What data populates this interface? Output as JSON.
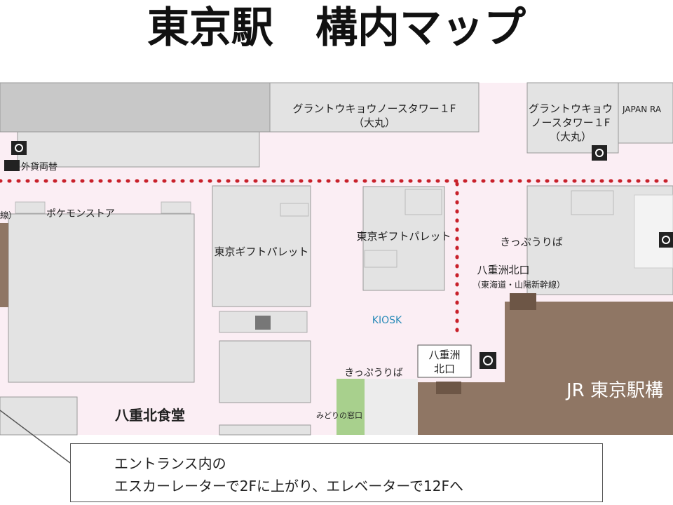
{
  "title": "東京駅　構内マップ",
  "labels": {
    "granto_left_1": "グラントウキョウノースタワー１F",
    "granto_left_2": "（大丸）",
    "granto_right_1": "グラントウキョウ",
    "granto_right_2": "ノースタワー１F",
    "granto_right_3": "（大丸）",
    "japan_rail": "JAPAN RA",
    "exchange": "外貨両替",
    "kanji_left": "線）",
    "pokemon": "ポケモンストア",
    "gift1": "東京ギフトパレット",
    "gift2": "東京ギフトパレット",
    "kippu1": "きっぷうりば",
    "yaesu_north_1": "八重洲北口",
    "yaesu_north_2": "（東海道・山陽新幹線）",
    "kiosk": "KIOSK",
    "gate_1": "八重洲",
    "gate_2": "北口",
    "kippu2": "きっぷうりば",
    "midori": "みどりの窓口",
    "yaesu_dining": "八重北食堂",
    "jr": "JR 東京駅構"
  },
  "callout": {
    "line1": "エントランス内の",
    "line2": "エスカーレーターで2Fに上がり、エレベーターで12Fへ"
  },
  "colors": {
    "concourse": "#fbeef4",
    "block": "#e3e3e3",
    "block_dark": "#c8c8c8",
    "jr_area": "#8f7664",
    "midori": "#a8d08d",
    "dotted_route": "#c8202a",
    "kiosk": "#2a8bb8"
  }
}
